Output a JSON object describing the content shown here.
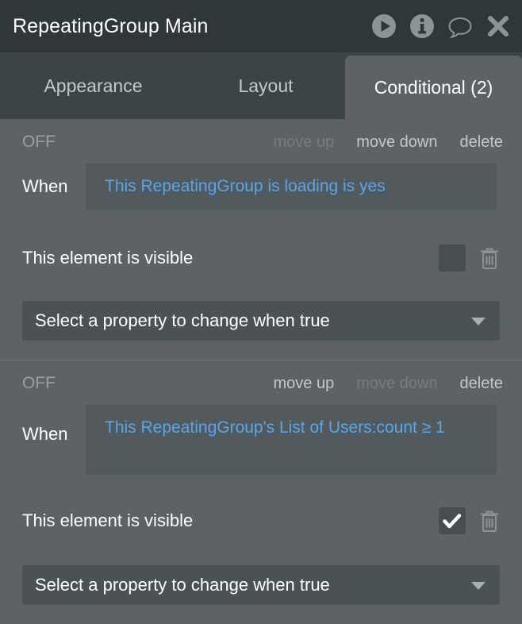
{
  "window": {
    "title": "RepeatingGroup Main",
    "icons": [
      {
        "name": "play-icon"
      },
      {
        "name": "info-icon"
      },
      {
        "name": "comment-icon"
      },
      {
        "name": "close-icon"
      }
    ]
  },
  "tabs": [
    {
      "label": "Appearance",
      "active": false
    },
    {
      "label": "Layout",
      "active": false
    },
    {
      "label": "Conditional (2)",
      "active": true
    }
  ],
  "conditions": [
    {
      "toggle_label": "OFF",
      "actions": [
        {
          "label": "move up",
          "enabled": false
        },
        {
          "label": "move down",
          "enabled": true
        },
        {
          "label": "delete",
          "enabled": true
        }
      ],
      "when_label": "When",
      "expression": "This RepeatingGroup is loading is yes",
      "property_label": "This element is visible",
      "checked": false,
      "select_label": "Select a property to change when true"
    },
    {
      "toggle_label": "OFF",
      "actions": [
        {
          "label": "move up",
          "enabled": true
        },
        {
          "label": "move down",
          "enabled": false
        },
        {
          "label": "delete",
          "enabled": true
        }
      ],
      "when_label": "When",
      "expression": "This RepeatingGroup's List of Users:count ≥ 1",
      "property_label": "This element is visible",
      "checked": true,
      "select_label": "Select a property to change when true"
    }
  ],
  "colors": {
    "titlebar_bg": "#2f3739",
    "tabstrip_bg": "#3c4447",
    "body_bg": "#5c6265",
    "expression_text": "#5aa5e8",
    "field_bg": "#525a5d"
  }
}
